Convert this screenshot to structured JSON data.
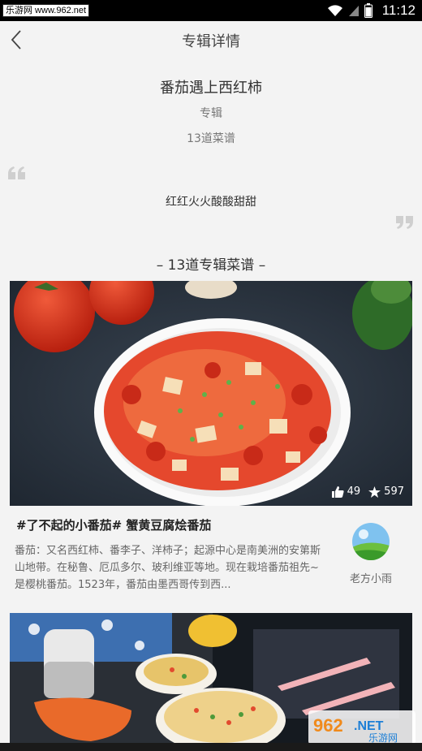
{
  "status_bar": {
    "watermark": "乐游网 www.962.net",
    "time": "11:12"
  },
  "nav": {
    "title": "专辑详情"
  },
  "album": {
    "title": "番茄遇上西红柿",
    "type": "专辑",
    "count": "13道菜谱",
    "description": "红红火火酸酸甜甜"
  },
  "section_title": "– 13道专辑菜谱 –",
  "recipes": [
    {
      "likes": "49",
      "favorites": "597",
      "title": "#了不起的小番茄# 蟹黄豆腐烩番茄",
      "description": "番茄：又名西红柿、番李子、洋柿子；起源中心是南美洲的安第斯山地带。在秘鲁、厄瓜多尔、玻利维亚等地。现在栽培番茄祖先~是樱桃番茄。1523年，番茄由墨西哥传到西...",
      "author": "老方小雨"
    }
  ],
  "watermark_bottom": "962.NET 乐游网"
}
